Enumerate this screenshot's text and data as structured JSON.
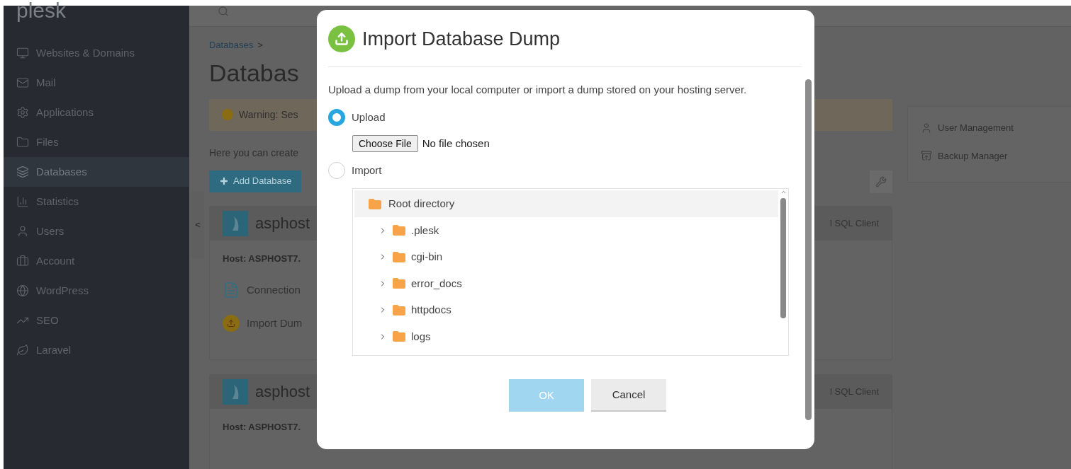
{
  "sidebar": {
    "logo": "plesk",
    "items": [
      {
        "label": "Websites & Domains",
        "selected": false
      },
      {
        "label": "Mail",
        "selected": false
      },
      {
        "label": "Applications",
        "selected": false
      },
      {
        "label": "Files",
        "selected": false
      },
      {
        "label": "Databases",
        "selected": true
      },
      {
        "label": "Statistics",
        "selected": false
      },
      {
        "label": "Users",
        "selected": false
      },
      {
        "label": "Account",
        "selected": false
      },
      {
        "label": "WordPress",
        "selected": false
      },
      {
        "label": "SEO",
        "selected": false
      },
      {
        "label": "Laravel",
        "selected": false
      }
    ]
  },
  "collapse_handle": "<",
  "breadcrumb": [
    "Databases",
    ">"
  ],
  "page_title": "Databas",
  "warning": "Warning: Ses",
  "intro": "Here you can create",
  "add_button": "Add Database",
  "databases": [
    {
      "name": "asphost",
      "host": "Host: ASPHOST7.",
      "client": "l SQL Client",
      "actions": [
        "Connection",
        "Import Dum"
      ]
    },
    {
      "name": "asphost",
      "host": "Host: ASPHOST7.",
      "client": "l SQL Client"
    }
  ],
  "side_links": [
    "User Management",
    "Backup Manager"
  ],
  "dialog": {
    "title": "Import Database Dump",
    "description": "Upload a dump from your local computer or import a dump stored on your hosting server.",
    "options": [
      {
        "label": "Upload",
        "selected": true
      },
      {
        "label": "Import",
        "selected": false
      }
    ],
    "file_button": "Choose File",
    "file_status": "No file chosen",
    "tree": {
      "label": "Root directory",
      "selected": true,
      "children": [
        {
          "label": ".plesk",
          "selected": false,
          "expanded": false
        },
        {
          "label": "cgi-bin",
          "selected": false,
          "expanded": false
        },
        {
          "label": "error_docs",
          "selected": false,
          "expanded": false
        },
        {
          "label": "httpdocs",
          "selected": false,
          "expanded": false
        },
        {
          "label": "logs",
          "selected": false,
          "expanded": false
        }
      ]
    },
    "buttons": [
      {
        "label": "OK",
        "kind": "primary",
        "disabled": true
      },
      {
        "label": "Cancel",
        "kind": "secondary",
        "disabled": false
      }
    ]
  }
}
